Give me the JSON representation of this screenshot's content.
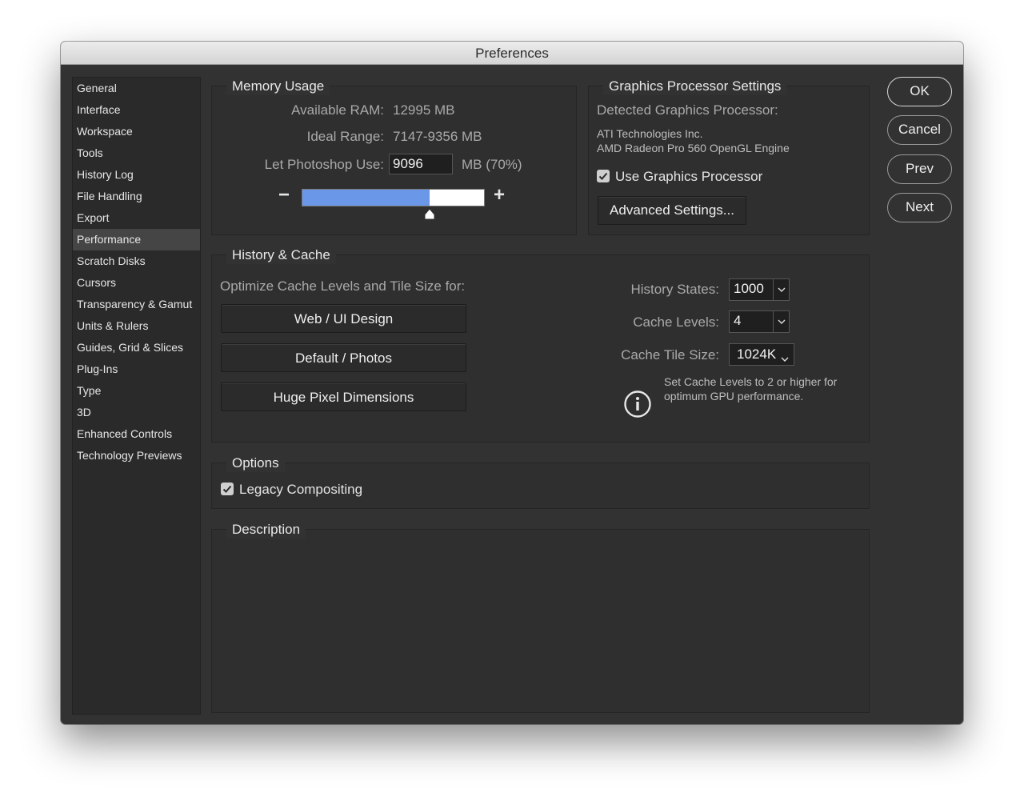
{
  "window": {
    "title": "Preferences"
  },
  "sidebar": {
    "items": [
      {
        "label": "General"
      },
      {
        "label": "Interface"
      },
      {
        "label": "Workspace"
      },
      {
        "label": "Tools"
      },
      {
        "label": "History Log"
      },
      {
        "label": "File Handling"
      },
      {
        "label": "Export"
      },
      {
        "label": "Performance",
        "selected": true
      },
      {
        "label": "Scratch Disks"
      },
      {
        "label": "Cursors"
      },
      {
        "label": "Transparency & Gamut"
      },
      {
        "label": "Units & Rulers"
      },
      {
        "label": "Guides, Grid & Slices"
      },
      {
        "label": "Plug-Ins"
      },
      {
        "label": "Type"
      },
      {
        "label": "3D"
      },
      {
        "label": "Enhanced Controls"
      },
      {
        "label": "Technology Previews"
      }
    ]
  },
  "memory": {
    "title": "Memory Usage",
    "available_label": "Available RAM:",
    "available_value": "12995 MB",
    "ideal_label": "Ideal Range:",
    "ideal_value": "7147-9356 MB",
    "use_label": "Let Photoshop Use:",
    "use_value": "9096",
    "use_suffix": "MB (70%)",
    "slider_fraction": 0.7,
    "minus": "−",
    "plus": "+"
  },
  "gpu": {
    "title": "Graphics Processor Settings",
    "detected_label": "Detected Graphics Processor:",
    "vendor": "ATI Technologies Inc.",
    "model": "AMD Radeon Pro 560 OpenGL Engine",
    "use_gpu_label": "Use Graphics Processor",
    "use_gpu_checked": true,
    "advanced_button": "Advanced Settings..."
  },
  "buttons": {
    "ok": "OK",
    "cancel": "Cancel",
    "prev": "Prev",
    "next": "Next"
  },
  "history_cache": {
    "title": "History & Cache",
    "optimize_label": "Optimize Cache Levels and Tile Size for:",
    "presets": [
      "Web / UI Design",
      "Default / Photos",
      "Huge Pixel Dimensions"
    ],
    "history_states_label": "History States:",
    "history_states_value": "1000",
    "cache_levels_label": "Cache Levels:",
    "cache_levels_value": "4",
    "tile_size_label": "Cache Tile Size:",
    "tile_size_value": "1024K",
    "info_line1": "Set Cache Levels to 2 or higher for",
    "info_line2": "optimum GPU performance."
  },
  "options": {
    "title": "Options",
    "legacy_label": "Legacy Compositing",
    "legacy_checked": true
  },
  "description": {
    "title": "Description"
  },
  "colors": {
    "accent": "#6a97e8",
    "background": "#323232"
  }
}
